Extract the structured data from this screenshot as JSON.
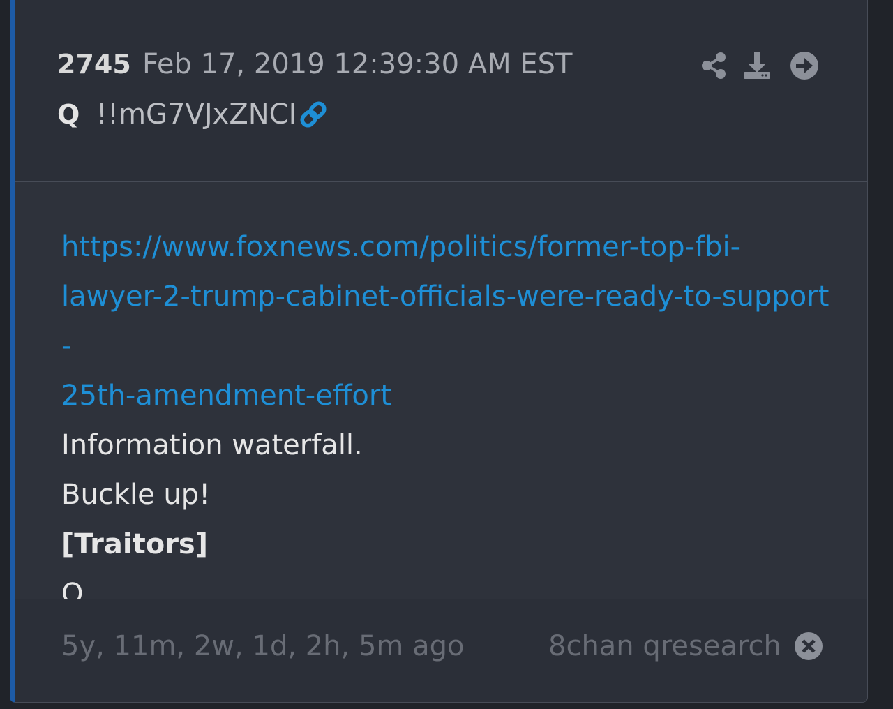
{
  "post": {
    "number": "2745",
    "date": "Feb 17, 2019 12:39:30 AM EST",
    "author": "Q",
    "tripcode": "!!mG7VJxZNCI"
  },
  "content": {
    "link": "https://www.foxnews.com/politics/former-top-fbi-lawyer-2-trump-cabinet-officials-were-ready-to-support-25th-amendment-effort",
    "link_lines": [
      "https://www.foxnews.com/politics/former-top-fbi-",
      "lawyer-2-trump-cabinet-officials-were-ready-to-support-",
      "25th-amendment-effort"
    ],
    "lines": [
      "Information waterfall.",
      "Buckle up!",
      "[Traitors]",
      "Q"
    ]
  },
  "footer": {
    "time_ago": "5y, 11m, 2w, 1d, 2h, 5m ago",
    "source": "8chan qresearch"
  },
  "icons": {
    "link": "link-icon",
    "share": "share-icon",
    "download": "download-icon",
    "next": "arrow-circle-right-icon",
    "close": "close-circle-icon"
  },
  "colors": {
    "accent": "#1d5ba6",
    "link": "#1e8fd6",
    "icon": "#8c9099"
  }
}
